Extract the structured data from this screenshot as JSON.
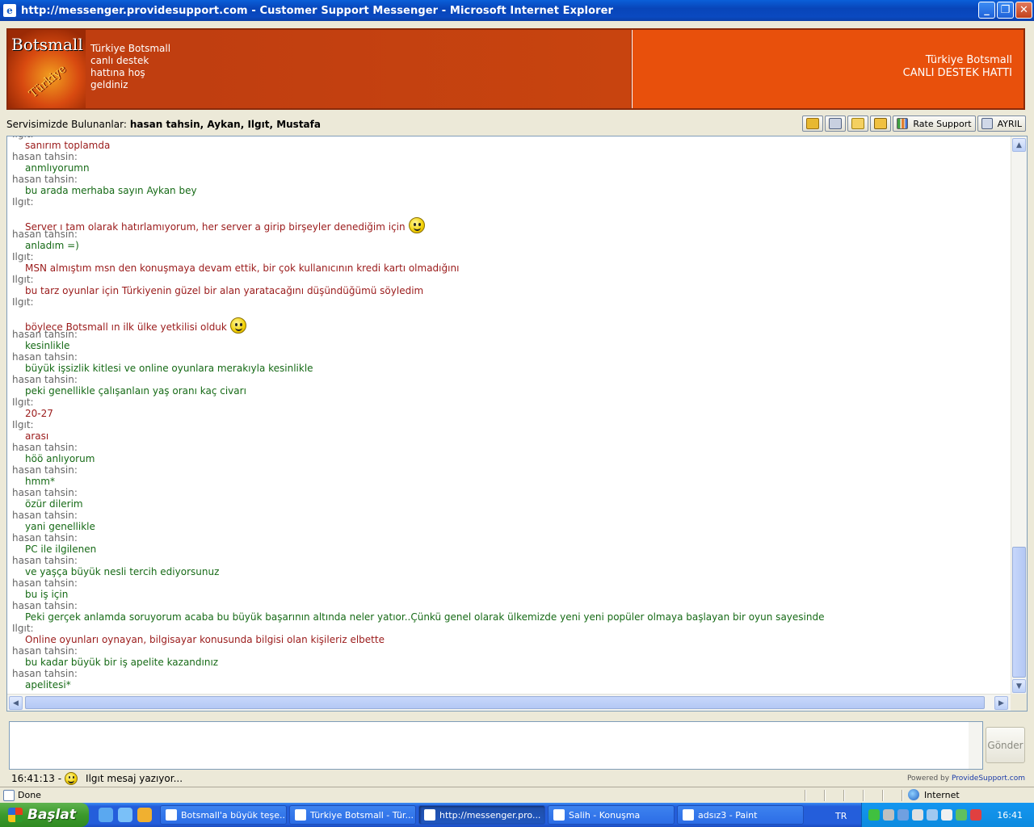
{
  "window": {
    "title": "http://messenger.providesupport.com - Customer Support Messenger - Microsoft Internet Explorer",
    "minimize": "_",
    "restore": "❐",
    "close": "✕"
  },
  "banner": {
    "logo_text": "Botsmall",
    "logo_sub": "Türkiye",
    "welcome": "Türkiye Botsmall canlı destek hattına hoş geldiniz",
    "right_line1": "Türkiye Botsmall",
    "right_line2": "CANLI DESTEK HATTI"
  },
  "operators": {
    "label": "Servisimizde Bulunanlar:",
    "names": "hasan tahsin, Aykan, Ilgıt, Mustafa"
  },
  "toolbar": {
    "rate_support": "Rate Support",
    "leave": "AYRIL"
  },
  "messages": [
    {
      "sender": "Ilgıt:",
      "text": "sanırım toplamda",
      "color": "red",
      "smiley": false
    },
    {
      "sender": "hasan tahsin:",
      "text": "anmlıyorumn",
      "color": "green",
      "smiley": false
    },
    {
      "sender": "hasan tahsin:",
      "text": "bu arada merhaba sayın Aykan bey",
      "color": "green",
      "smiley": false
    },
    {
      "sender": "Ilgıt:",
      "text": "Server ı tam olarak hatırlamıyorum, her server a girip birşeyler denediğim için",
      "color": "red",
      "smiley": true
    },
    {
      "sender": "hasan tahsin:",
      "text": "anladım =)",
      "color": "green",
      "smiley": false
    },
    {
      "sender": "Ilgıt:",
      "text": "MSN almıştım msn den konuşmaya devam ettik, bir çok kullanıcının kredi kartı olmadığını",
      "color": "red",
      "smiley": false
    },
    {
      "sender": "Ilgıt:",
      "text": "bu tarz oyunlar için Türkiyenin güzel bir alan yaratacağını düşündüğümü söyledim",
      "color": "red",
      "smiley": false
    },
    {
      "sender": "Ilgıt:",
      "text": "böylece Botsmall ın ilk ülke yetkilisi olduk",
      "color": "red",
      "smiley": true
    },
    {
      "sender": "hasan tahsin:",
      "text": "kesinlikle",
      "color": "green",
      "smiley": false
    },
    {
      "sender": "hasan tahsin:",
      "text": "büyük işsizlik kitlesi ve online oyunlara merakıyla kesinlikle",
      "color": "green",
      "smiley": false
    },
    {
      "sender": "hasan tahsin:",
      "text": "peki genellikle çalışanlaın yaş oranı kaç civarı",
      "color": "green",
      "smiley": false
    },
    {
      "sender": "Ilgıt:",
      "text": "20-27",
      "color": "red",
      "smiley": false
    },
    {
      "sender": "Ilgıt:",
      "text": "arası",
      "color": "red",
      "smiley": false
    },
    {
      "sender": "hasan tahsin:",
      "text": "höö anlıyorum",
      "color": "green",
      "smiley": false
    },
    {
      "sender": "hasan tahsin:",
      "text": "hmm*",
      "color": "green",
      "smiley": false
    },
    {
      "sender": "hasan tahsin:",
      "text": "özür dilerim",
      "color": "green",
      "smiley": false
    },
    {
      "sender": "hasan tahsin:",
      "text": "yani genellikle",
      "color": "green",
      "smiley": false
    },
    {
      "sender": "hasan tahsin:",
      "text": "PC ile ilgilenen",
      "color": "green",
      "smiley": false
    },
    {
      "sender": "hasan tahsin:",
      "text": "ve yaşça büyük nesli tercih ediyorsunuz",
      "color": "green",
      "smiley": false
    },
    {
      "sender": "hasan tahsin:",
      "text": "bu iş için",
      "color": "green",
      "smiley": false
    },
    {
      "sender": "hasan tahsin:",
      "text": "Peki gerçek anlamda soruyorum acaba bu büyük başarının altında neler yatıor..Çünkü genel olarak ülkemizde yeni yeni popüler olmaya başlayan bir oyun sayesinde",
      "color": "green",
      "smiley": false
    },
    {
      "sender": "Ilgıt:",
      "text": "Online oyunları oynayan, bilgisayar konusunda bilgisi olan kişileriz elbette",
      "color": "red",
      "smiley": false
    },
    {
      "sender": "hasan tahsin:",
      "text": "bu kadar büyük bir iş apelite kazandınız",
      "color": "green",
      "smiley": false
    },
    {
      "sender": "hasan tahsin:",
      "text": "apelitesi*",
      "color": "green",
      "smiley": false
    }
  ],
  "colors": {
    "green": "#166a16",
    "red": "#9a1a1a"
  },
  "input": {
    "value": "",
    "placeholder": ""
  },
  "send_button": "Gönder",
  "status": {
    "time": "16:41:13 -",
    "typing": "Ilgıt mesaj yazıyor..."
  },
  "powered": {
    "prefix": "Powered by",
    "brand": "ProvideSupport.com"
  },
  "ie_status": {
    "left": "Done",
    "zone": "Internet"
  },
  "taskbar": {
    "start": "Başlat",
    "tasks": [
      {
        "label": "Botsmall'a büyük teşe...",
        "active": false
      },
      {
        "label": "Türkiye Botsmall - Tür...",
        "active": false
      },
      {
        "label": "http://messenger.pro...",
        "active": true
      },
      {
        "label": "Salih - Konuşma",
        "active": false
      },
      {
        "label": "adsız3 - Paint",
        "active": false
      }
    ],
    "lang": "TR",
    "clock": "16:41"
  }
}
